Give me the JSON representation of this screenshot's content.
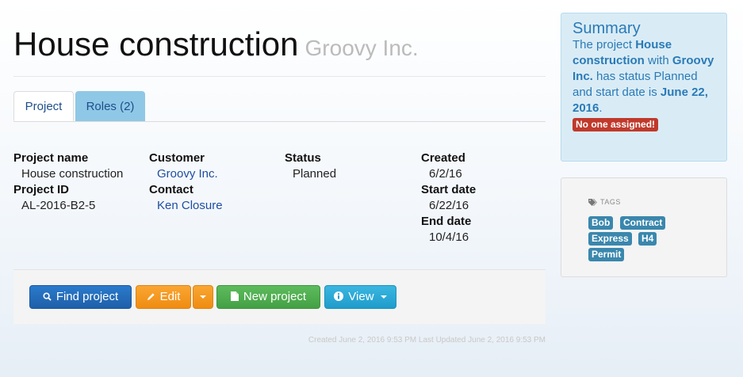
{
  "header": {
    "title": "House construction",
    "company": "Groovy Inc."
  },
  "tabs": [
    {
      "label": "Project"
    },
    {
      "label": "Roles (2)"
    }
  ],
  "fields": {
    "project_name_label": "Project name",
    "project_name": "House construction",
    "project_id_label": "Project ID",
    "project_id": "AL-2016-B2-5",
    "customer_label": "Customer",
    "customer": "Groovy Inc.",
    "contact_label": "Contact",
    "contact": "Ken Closure",
    "status_label": "Status",
    "status": "Planned",
    "created_label": "Created",
    "created": "6/2/16",
    "start_label": "Start date",
    "start": "6/22/16",
    "end_label": "End date",
    "end": "10/4/16"
  },
  "actions": {
    "find": "Find project",
    "edit": "Edit",
    "new": "New project",
    "view": "View"
  },
  "meta": {
    "audit": "Created June 2, 2016 9:53 PM Last Updated June 2, 2016 9:53 PM"
  },
  "summary": {
    "heading": "Summary",
    "text1": "The project ",
    "project": "House construction",
    "text2": " with ",
    "company": "Groovy Inc.",
    "text3": " has status Planned and start date is ",
    "start": "June 22, 2016",
    "text4": ".",
    "badge": "No one assigned!"
  },
  "tags": {
    "heading": "TAGS",
    "items": [
      "Bob",
      "Contract",
      "Express",
      "H4",
      "Permit"
    ]
  },
  "colors": {
    "find_button": "#2a6fbb",
    "edit_button": "#f39a20",
    "new_button": "#4cae4c",
    "view_button": "#2aa8d6",
    "badge": "#c0392b",
    "tag": "#3a87ad",
    "summary_bg": "#d9ecf6"
  },
  "icons": [
    "search-icon",
    "pencil-icon",
    "document-icon",
    "info-icon",
    "tags-icon",
    "caret-down-icon"
  ]
}
